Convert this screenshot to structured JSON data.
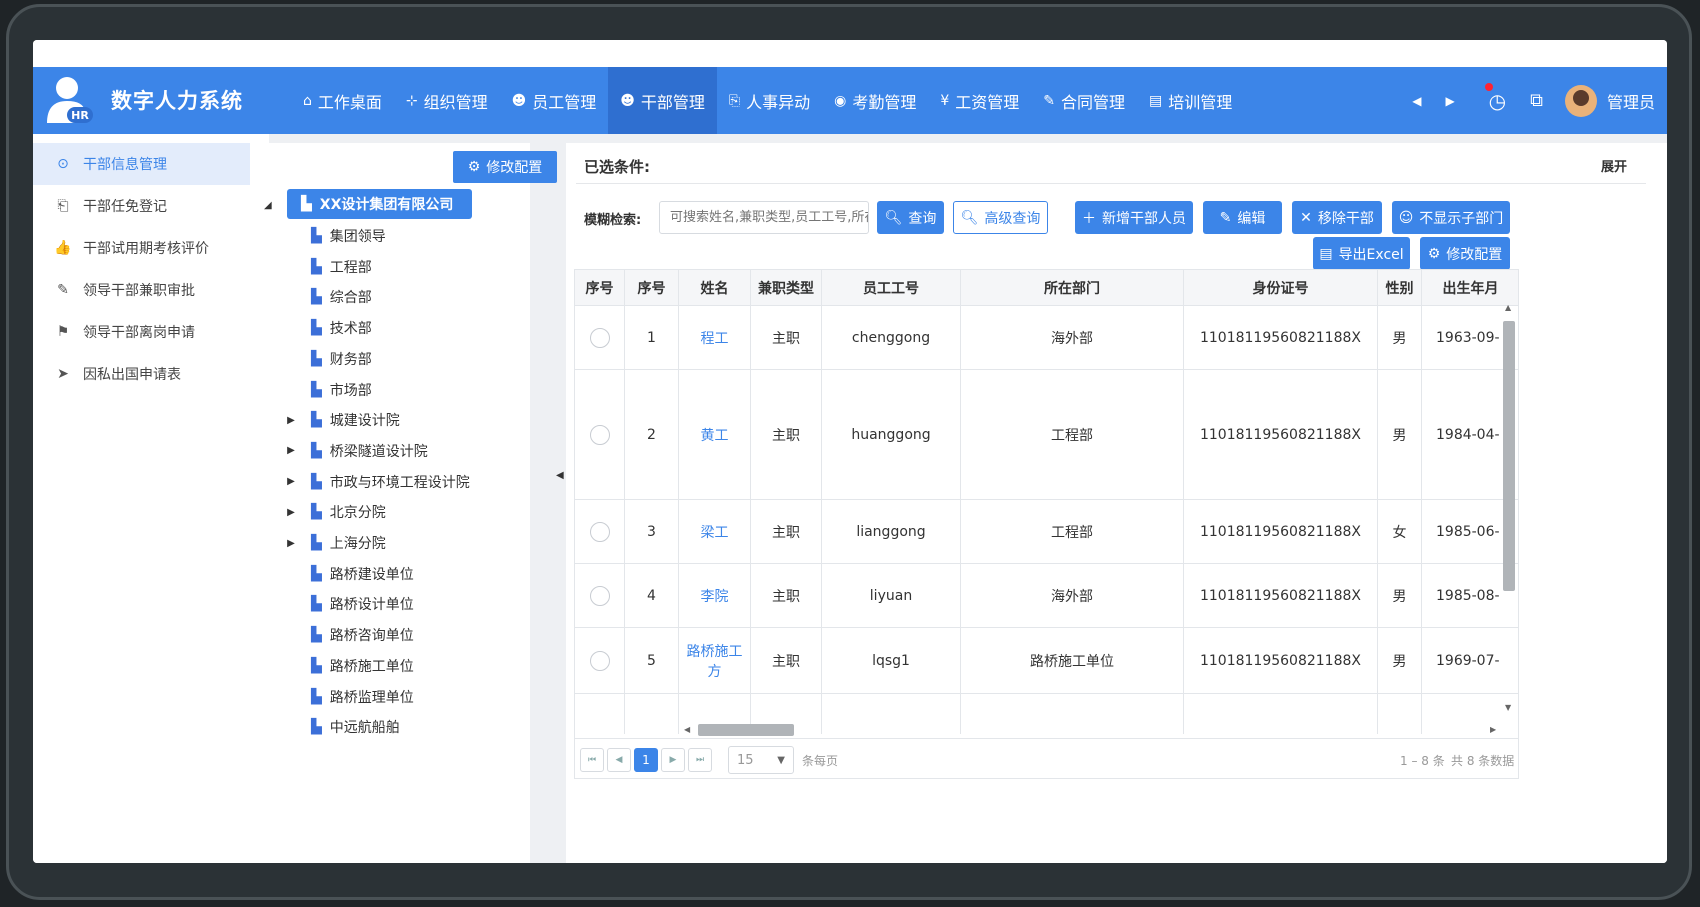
{
  "app": {
    "title": "数字人力系统",
    "logo_text": "HR"
  },
  "nav": [
    {
      "icon": "⌂",
      "label": "工作桌面"
    },
    {
      "icon": "⊹",
      "label": "组织管理"
    },
    {
      "icon": "☻",
      "label": "员工管理"
    },
    {
      "icon": "☻",
      "label": "干部管理",
      "active": true
    },
    {
      "icon": "⎘",
      "label": "人事异动"
    },
    {
      "icon": "◉",
      "label": "考勤管理"
    },
    {
      "icon": "¥",
      "label": "工资管理"
    },
    {
      "icon": "✎",
      "label": "合同管理"
    },
    {
      "icon": "▤",
      "label": "培训管理"
    }
  ],
  "header_right": {
    "prev": "◀",
    "next": "▶",
    "clock": "◷",
    "window": "⧉",
    "admin": "管理员"
  },
  "sidebar": [
    {
      "icon": "⊙",
      "label": "干部信息管理",
      "active": true
    },
    {
      "icon": "⎗",
      "label": "干部任免登记"
    },
    {
      "icon": "👍",
      "label": "干部试用期考核评价"
    },
    {
      "icon": "✎",
      "label": "领导干部兼职审批"
    },
    {
      "icon": "⚑",
      "label": "领导干部离岗申请"
    },
    {
      "icon": "➤",
      "label": "因私出国申请表"
    }
  ],
  "tree": {
    "config_button": "修改配置",
    "root": "XX设计集团有限公司",
    "nodes": [
      {
        "label": "集团领导",
        "expandable": false
      },
      {
        "label": "工程部",
        "expandable": false
      },
      {
        "label": "综合部",
        "expandable": false
      },
      {
        "label": "技术部",
        "expandable": false
      },
      {
        "label": "财务部",
        "expandable": false
      },
      {
        "label": "市场部",
        "expandable": false
      },
      {
        "label": "城建设计院",
        "expandable": true
      },
      {
        "label": "桥梁隧道设计院",
        "expandable": true
      },
      {
        "label": "市政与环境工程设计院",
        "expandable": true
      },
      {
        "label": "北京分院",
        "expandable": true
      },
      {
        "label": "上海分院",
        "expandable": true
      },
      {
        "label": "路桥建设单位",
        "expandable": false
      },
      {
        "label": "路桥设计单位",
        "expandable": false
      },
      {
        "label": "路桥咨询单位",
        "expandable": false
      },
      {
        "label": "路桥施工单位",
        "expandable": false
      },
      {
        "label": "路桥监理单位",
        "expandable": false
      },
      {
        "label": "中远航船舶",
        "expandable": false
      }
    ]
  },
  "main": {
    "conditions_label": "已选条件:",
    "expand": "展开",
    "search_label": "模糊检索:",
    "search_placeholder": "可搜索姓名,兼职类型,员工工号,所在部门",
    "buttons": {
      "query": "查询",
      "advanced": "高级查询",
      "add": "新增干部人员",
      "edit": "编辑",
      "remove": "移除干部",
      "hide_sub": "不显示子部门",
      "export": "导出Excel",
      "config": "修改配置"
    }
  },
  "table": {
    "headers": [
      "序号",
      "序号",
      "姓名",
      "兼职类型",
      "员工工号",
      "所在部门",
      "身份证号",
      "性别",
      "出生年月"
    ],
    "rows": [
      {
        "no": "1",
        "name": "程工",
        "type": "主职",
        "empno": "chenggong",
        "dept": "海外部",
        "id": "11018119560821188X",
        "sex": "男",
        "birth": "1963-09-"
      },
      {
        "no": "2",
        "name": "黄工",
        "type": "主职",
        "empno": "huanggong",
        "dept": "工程部",
        "id": "11018119560821188X",
        "sex": "男",
        "birth": "1984-04-"
      },
      {
        "no": "3",
        "name": "梁工",
        "type": "主职",
        "empno": "lianggong",
        "dept": "工程部",
        "id": "11018119560821188X",
        "sex": "女",
        "birth": "1985-06-"
      },
      {
        "no": "4",
        "name": "李院",
        "type": "主职",
        "empno": "liyuan",
        "dept": "海外部",
        "id": "11018119560821188X",
        "sex": "男",
        "birth": "1985-08-"
      },
      {
        "no": "5",
        "name": "路桥施工方",
        "type": "主职",
        "empno": "lqsg1",
        "dept": "路桥施工单位",
        "id": "11018119560821188X",
        "sex": "男",
        "birth": "1969-07-"
      }
    ]
  },
  "pager": {
    "current": "1",
    "page_size": "15",
    "per_page_label": "条每页",
    "range": "1 – 8 条",
    "total": "共 8 条数据"
  }
}
